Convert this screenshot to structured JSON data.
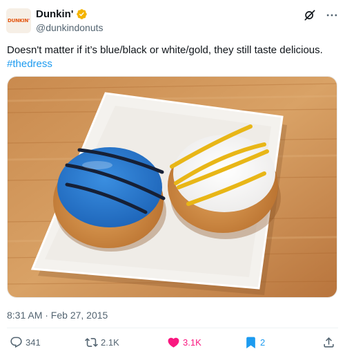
{
  "author": {
    "display_name": "Dunkin'",
    "handle": "@dunkindonuts",
    "avatar_text_main": "DUNKIN",
    "avatar_text_accent": "'",
    "verified": true,
    "verified_color": "#f4b400"
  },
  "tweet": {
    "text": "Doesn't matter if it’s blue/black or white/gold, they still taste delicious.",
    "hashtag": "#thedress",
    "timestamp": "8:31 AM · Feb 27, 2015"
  },
  "media": {
    "description_icon": "photo"
  },
  "actions": {
    "reply_count": "341",
    "repost_count": "2.1K",
    "like_count": "3.1K",
    "bookmark_count": "2"
  },
  "colors": {
    "accent": "#1d9bf0",
    "like": "#f91880",
    "text": "#0f1419",
    "secondary": "#536471"
  },
  "icons": [
    "verified-badge-icon",
    "grok-icon",
    "more-icon",
    "reply-icon",
    "repost-icon",
    "heart-icon",
    "bookmark-icon",
    "share-icon"
  ]
}
